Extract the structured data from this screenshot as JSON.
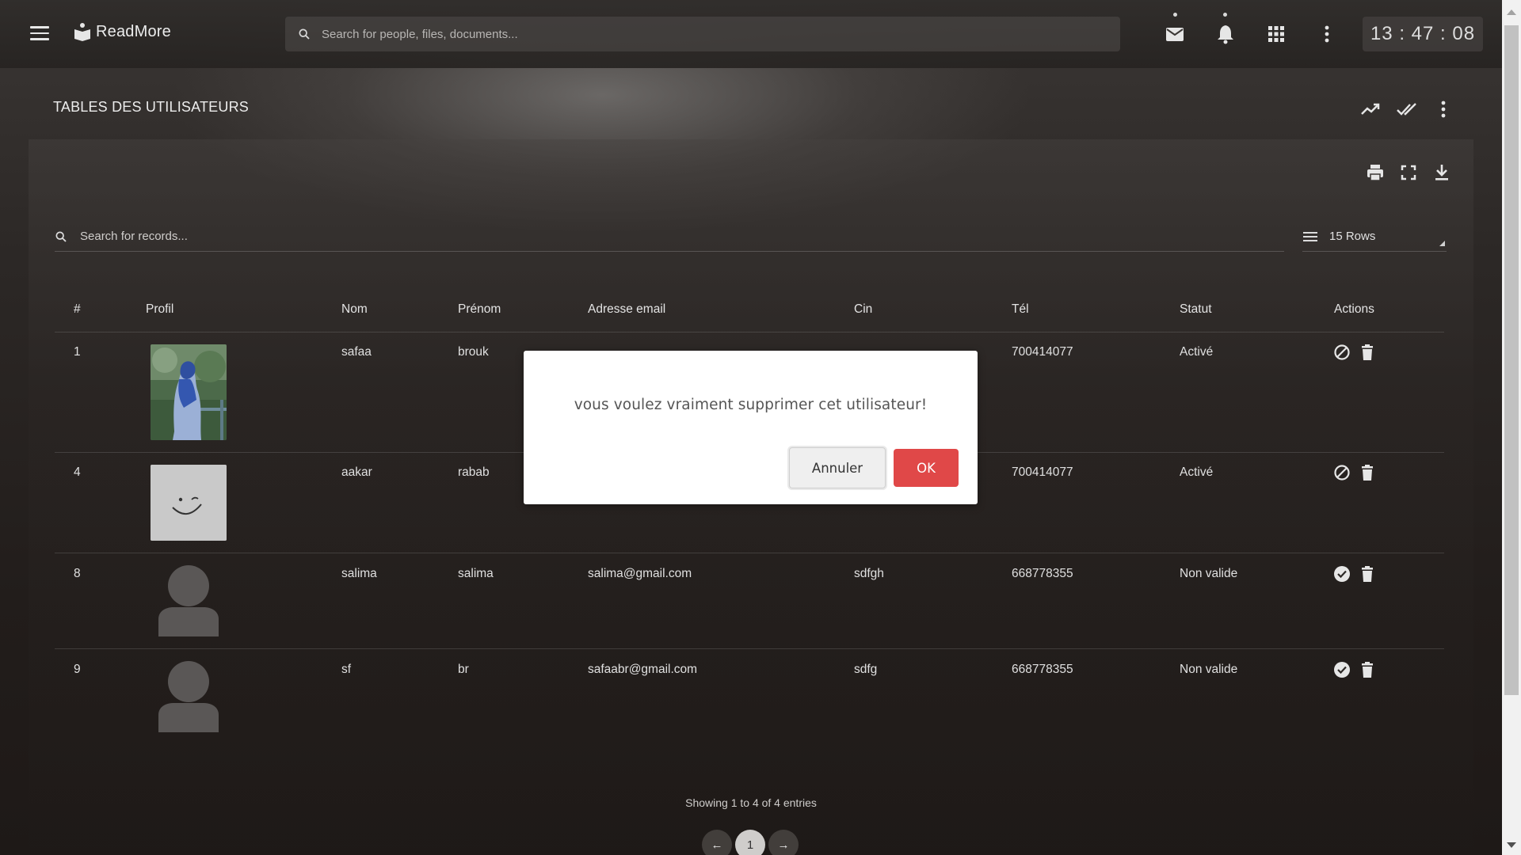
{
  "header": {
    "brand": "ReadMore",
    "search_placeholder": "Search for people, files, documents...",
    "clock": "13 : 47 : 08"
  },
  "page": {
    "title": "TABLES DES UTILISATEURS"
  },
  "table": {
    "search_placeholder": "Search for records...",
    "rows_select": "15 Rows",
    "columns": [
      "#",
      "Profil",
      "Nom",
      "Prénom",
      "Adresse email",
      "Cin",
      "Tél",
      "Statut",
      "Actions"
    ],
    "rows": [
      {
        "id": "1",
        "nom": "safaa",
        "prenom": "brouk",
        "email": "",
        "cin": "",
        "tel": "700414077",
        "statut": "Activé",
        "avatar": "photo",
        "action_icon": "block-icon"
      },
      {
        "id": "4",
        "nom": "aakar",
        "prenom": "rabab",
        "email": "",
        "cin": "",
        "tel": "700414077",
        "statut": "Activé",
        "avatar": "smiley",
        "action_icon": "block-icon"
      },
      {
        "id": "8",
        "nom": "salima",
        "prenom": "salima",
        "email": "salima@gmail.com",
        "cin": "sdfgh",
        "tel": "668778355",
        "statut": "Non valide",
        "avatar": "default",
        "action_icon": "check-circle-icon"
      },
      {
        "id": "9",
        "nom": "sf",
        "prenom": "br",
        "email": "safaabr@gmail.com",
        "cin": "sdfg",
        "tel": "668778355",
        "statut": "Non valide",
        "avatar": "default",
        "action_icon": "check-circle-icon"
      }
    ],
    "footer": "Showing 1 to 4 of 4 entries",
    "pagination": {
      "prev": "←",
      "current": "1",
      "next": "→"
    }
  },
  "modal": {
    "message": "vous voulez vraiment supprimer cet utilisateur!",
    "cancel_label": "Annuler",
    "ok_label": "OK"
  },
  "colors": {
    "ok_button": "#e04848",
    "modal_bg": "#ffffff"
  }
}
